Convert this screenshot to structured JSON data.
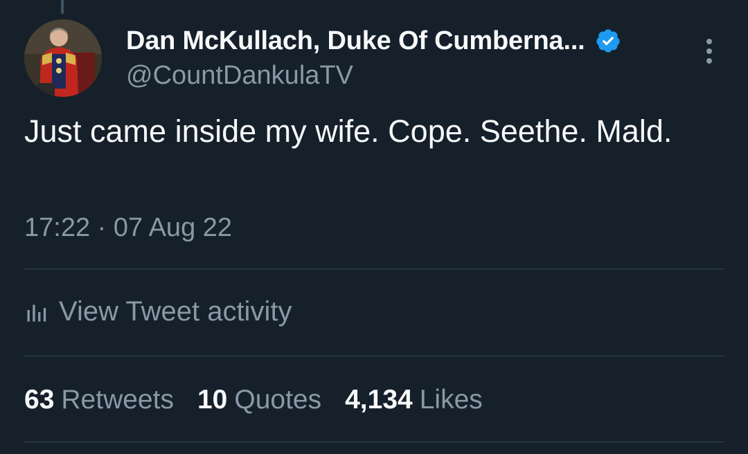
{
  "author": {
    "display_name": "Dan McKullach, Duke Of Cumberna...",
    "handle": "@CountDankulaTV",
    "verified": true,
    "avatar_icon": "portrait-avatar"
  },
  "tweet": {
    "text": "Just came inside my wife. Cope. Seethe. Mald.",
    "timestamp": "17:22 · 07 Aug 22"
  },
  "activity": {
    "label": "View Tweet activity",
    "icon": "bar-chart-icon"
  },
  "stats": {
    "retweets": {
      "count": "63",
      "label": "Retweets"
    },
    "quotes": {
      "count": "10",
      "label": "Quotes"
    },
    "likes": {
      "count": "4,134",
      "label": "Likes"
    }
  },
  "colors": {
    "background": "#15202b",
    "text_primary": "#f7f9f9",
    "text_secondary": "#8b98a5",
    "verified_blue": "#1d9bf0",
    "divider": "#38444d"
  }
}
